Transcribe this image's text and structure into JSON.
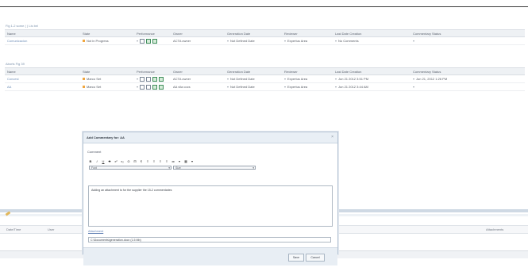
{
  "section1": {
    "title": "Fig 1-2 some ( ) Lis bel",
    "headers": [
      "Name",
      "State",
      "Performance",
      "Owner",
      "Generation Date",
      "Reviewer",
      "Last Date Creation",
      "Commentary Status"
    ],
    "rows": [
      {
        "name": "Comunicacion",
        "state": "Not in Progress",
        "performance": "",
        "owner": "ACTA owner",
        "generation_date": "Not Defined Date",
        "reviewer": "Expertus Area",
        "last_date": "No Comments",
        "commentary": ""
      }
    ]
  },
  "section2": {
    "title": "Aborts Fig 39",
    "headers": [
      "Name",
      "State",
      "Performance",
      "Owner",
      "Generation Date",
      "Reviewer",
      "Last Date Creation",
      "Commentary Status"
    ],
    "rows": [
      {
        "name": "Concesi",
        "state": "Marco Set",
        "performance": "",
        "owner": "ACTA owner",
        "generation_date": "Not Defined Date",
        "reviewer": "Expertus Area",
        "last_date": "Jun 21 2012 3:51 PM",
        "commentary": "Jun 21, 2012 1:26 PM"
      },
      {
        "name": "AA",
        "state": "Marco Set",
        "performance": "",
        "owner": "AA vila cocs",
        "generation_date": "Not Defined Date",
        "reviewer": "Expertus Area",
        "last_date": "Jun 21 2012 3:44 AM",
        "commentary": ""
      }
    ]
  },
  "bottom_table": {
    "headers": [
      "Date/Time",
      "User",
      "Attachments"
    ]
  },
  "dialog": {
    "title": "Add Commentary for: AA",
    "close_symbol": "×",
    "comment_label": "Comment",
    "toolbar": [
      "B",
      "I",
      "U",
      "S",
      "x²",
      "x₂",
      "Ω",
      "⊟",
      "¶",
      "≡",
      "≡",
      "≡",
      "≡",
      "≔",
      "▾",
      "▦",
      "▾"
    ],
    "font_select": "Font",
    "size_select": "Size",
    "editor_text": "Adding an attachment to for the supplier the 15-2 commentaries",
    "attachment_link": "Attachment",
    "attachment_value": "C:\\Documents\\generation.docx (1.5 Mb)",
    "save_label": "Save",
    "cancel_label": "Cancel"
  }
}
